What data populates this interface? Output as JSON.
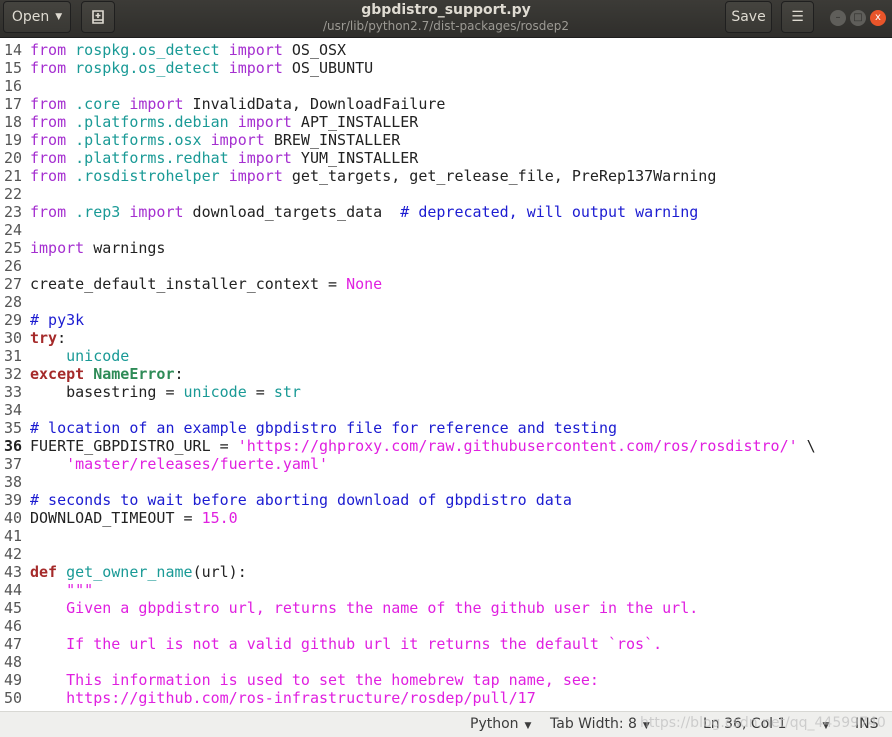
{
  "window": {
    "title": "gbpdistro_support.py",
    "subtitle": "/usr/lib/python2.7/dist-packages/rosdep2",
    "open_label": "Open",
    "save_label": "Save",
    "close_glyph": "x"
  },
  "editor": {
    "current_line": 36,
    "lines": [
      {
        "n": 14,
        "t": [
          [
            "k",
            "from"
          ],
          [
            "p",
            " "
          ],
          [
            "m",
            "rospkg.os_detect"
          ],
          [
            "p",
            " "
          ],
          [
            "k",
            "import"
          ],
          [
            "p",
            " OS_OSX"
          ]
        ]
      },
      {
        "n": 15,
        "t": [
          [
            "k",
            "from"
          ],
          [
            "p",
            " "
          ],
          [
            "m",
            "rospkg.os_detect"
          ],
          [
            "p",
            " "
          ],
          [
            "k",
            "import"
          ],
          [
            "p",
            " OS_UBUNTU"
          ]
        ]
      },
      {
        "n": 16,
        "t": []
      },
      {
        "n": 17,
        "t": [
          [
            "k",
            "from"
          ],
          [
            "p",
            " "
          ],
          [
            "m",
            ".core"
          ],
          [
            "p",
            " "
          ],
          [
            "k",
            "import"
          ],
          [
            "p",
            " InvalidData, DownloadFailure"
          ]
        ]
      },
      {
        "n": 18,
        "t": [
          [
            "k",
            "from"
          ],
          [
            "p",
            " "
          ],
          [
            "m",
            ".platforms.debian"
          ],
          [
            "p",
            " "
          ],
          [
            "k",
            "import"
          ],
          [
            "p",
            " APT_INSTALLER"
          ]
        ]
      },
      {
        "n": 19,
        "t": [
          [
            "k",
            "from"
          ],
          [
            "p",
            " "
          ],
          [
            "m",
            ".platforms.osx"
          ],
          [
            "p",
            " "
          ],
          [
            "k",
            "import"
          ],
          [
            "p",
            " BREW_INSTALLER"
          ]
        ]
      },
      {
        "n": 20,
        "t": [
          [
            "k",
            "from"
          ],
          [
            "p",
            " "
          ],
          [
            "m",
            ".platforms.redhat"
          ],
          [
            "p",
            " "
          ],
          [
            "k",
            "import"
          ],
          [
            "p",
            " YUM_INSTALLER"
          ]
        ]
      },
      {
        "n": 21,
        "t": [
          [
            "k",
            "from"
          ],
          [
            "p",
            " "
          ],
          [
            "m",
            ".rosdistrohelper"
          ],
          [
            "p",
            " "
          ],
          [
            "k",
            "import"
          ],
          [
            "p",
            " get_targets, get_release_file, PreRep137Warning"
          ]
        ]
      },
      {
        "n": 22,
        "t": []
      },
      {
        "n": 23,
        "t": [
          [
            "k",
            "from"
          ],
          [
            "p",
            " "
          ],
          [
            "m",
            ".rep3"
          ],
          [
            "p",
            " "
          ],
          [
            "k",
            "import"
          ],
          [
            "p",
            " download_targets_data  "
          ],
          [
            "c",
            "# deprecated, will output warning"
          ]
        ]
      },
      {
        "n": 24,
        "t": []
      },
      {
        "n": 25,
        "t": [
          [
            "k",
            "import"
          ],
          [
            "p",
            " warnings"
          ]
        ]
      },
      {
        "n": 26,
        "t": []
      },
      {
        "n": 27,
        "t": [
          [
            "p",
            "create_default_installer_context = "
          ],
          [
            "n",
            "None"
          ]
        ]
      },
      {
        "n": 28,
        "t": []
      },
      {
        "n": 29,
        "t": [
          [
            "c",
            "# py3k"
          ]
        ]
      },
      {
        "n": 30,
        "t": [
          [
            "b",
            "try"
          ],
          [
            "p",
            ":"
          ]
        ]
      },
      {
        "n": 31,
        "t": [
          [
            "p",
            "    "
          ],
          [
            "m",
            "unicode"
          ]
        ]
      },
      {
        "n": 32,
        "t": [
          [
            "b",
            "except"
          ],
          [
            "p",
            " "
          ],
          [
            "e",
            "NameError"
          ],
          [
            "p",
            ":"
          ]
        ]
      },
      {
        "n": 33,
        "t": [
          [
            "p",
            "    basestring = "
          ],
          [
            "m",
            "unicode"
          ],
          [
            "p",
            " = "
          ],
          [
            "m",
            "str"
          ]
        ]
      },
      {
        "n": 34,
        "t": []
      },
      {
        "n": 35,
        "t": [
          [
            "c",
            "# location of an example gbpdistro file for reference and testing"
          ]
        ]
      },
      {
        "n": 36,
        "t": [
          [
            "p",
            "FUERTE_GBPDISTRO_URL = "
          ],
          [
            "s",
            "'https://ghproxy.com/raw.githubusercontent.com/ros/rosdistro/'"
          ],
          [
            "p",
            " \\"
          ]
        ]
      },
      {
        "n": 37,
        "t": [
          [
            "p",
            "    "
          ],
          [
            "s",
            "'master/releases/fuerte.yaml'"
          ]
        ]
      },
      {
        "n": 38,
        "t": []
      },
      {
        "n": 39,
        "t": [
          [
            "c",
            "# seconds to wait before aborting download of gbpdistro data"
          ]
        ]
      },
      {
        "n": 40,
        "t": [
          [
            "p",
            "DOWNLOAD_TIMEOUT = "
          ],
          [
            "n",
            "15.0"
          ]
        ]
      },
      {
        "n": 41,
        "t": []
      },
      {
        "n": 42,
        "t": []
      },
      {
        "n": 43,
        "t": [
          [
            "b",
            "def"
          ],
          [
            "p",
            " "
          ],
          [
            "m",
            "get_owner_name"
          ],
          [
            "p",
            "(url):"
          ]
        ]
      },
      {
        "n": 44,
        "t": [
          [
            "p",
            "    "
          ],
          [
            "s",
            "\"\"\""
          ]
        ]
      },
      {
        "n": 45,
        "t": [
          [
            "s",
            "    Given a gbpdistro url, returns the name of the github user in the url."
          ]
        ]
      },
      {
        "n": 46,
        "t": []
      },
      {
        "n": 47,
        "t": [
          [
            "s",
            "    If the url is not a valid github url it returns the default `ros`."
          ]
        ]
      },
      {
        "n": 48,
        "t": []
      },
      {
        "n": 49,
        "t": [
          [
            "s",
            "    This information is used to set the homebrew tap name, see:"
          ]
        ]
      },
      {
        "n": 50,
        "t": [
          [
            "s",
            "    https://github.com/ros-infrastructure/rosdep/pull/17"
          ]
        ]
      }
    ]
  },
  "statusbar": {
    "language": "Python",
    "tab_width": "Tab Width: 8",
    "position": "Ln 36, Col 1",
    "mode": "INS",
    "watermark": "https://blog.csdn.net/qq_44599740"
  }
}
